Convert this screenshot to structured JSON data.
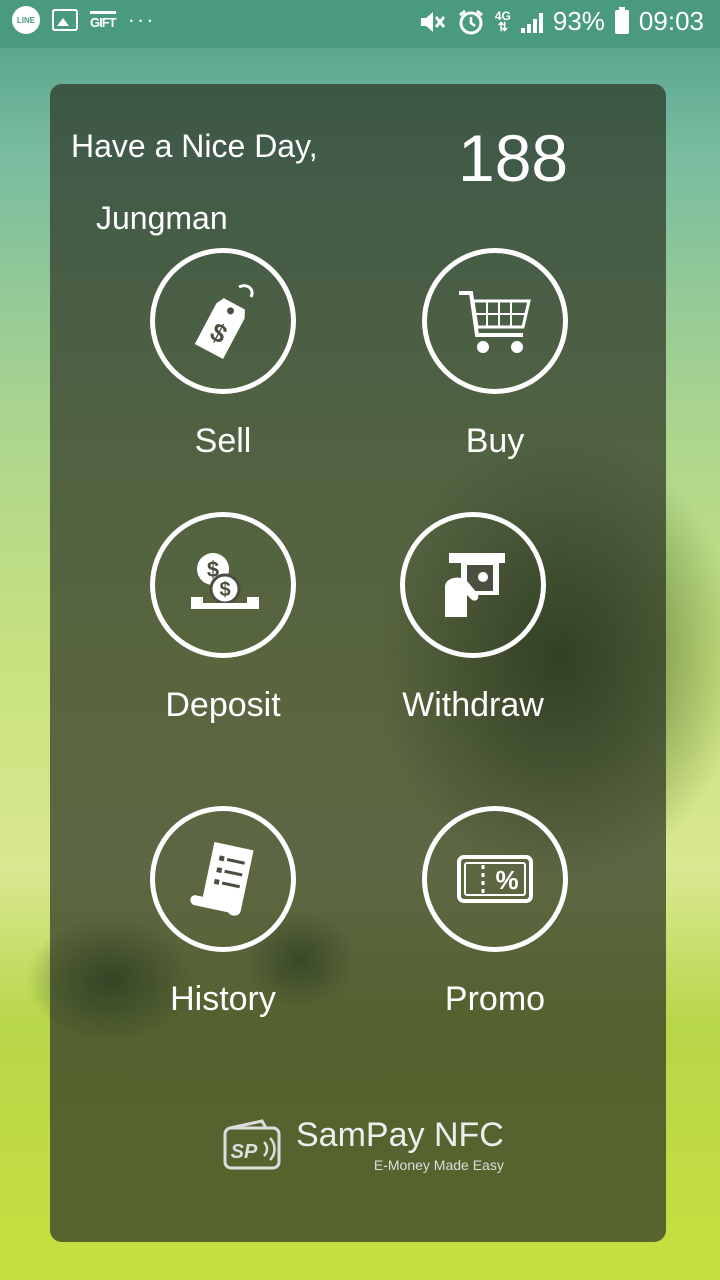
{
  "status_bar": {
    "line_label": "LINE",
    "gift_label": "GIFT",
    "more": "···",
    "network": "4G",
    "battery": "93%",
    "time": "09:03"
  },
  "greeting": "Have a Nice Day,",
  "user_name": "Jungman",
  "balance": "188",
  "actions": {
    "sell": "Sell",
    "buy": "Buy",
    "deposit": "Deposit",
    "withdraw": "Withdraw",
    "history": "History",
    "promo": "Promo"
  },
  "brand": {
    "badge": "SP",
    "title": "SamPay NFC",
    "tagline": "E-Money Made Easy"
  }
}
